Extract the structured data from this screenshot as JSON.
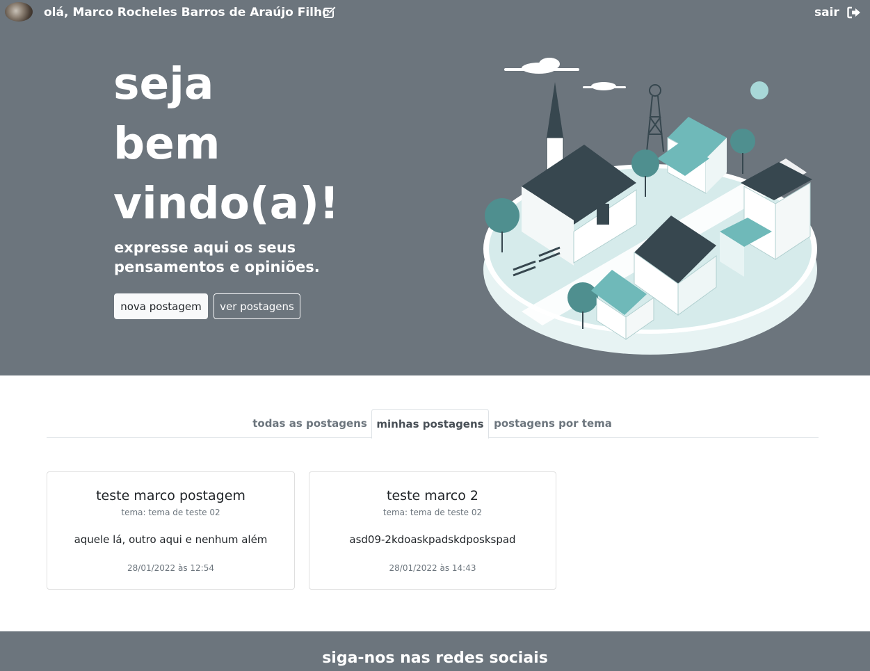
{
  "topbar": {
    "greeting": "olá, Marco Rocheles Barros de Araújo Filho",
    "edit_icon": "edit-icon",
    "logout_label": "sair",
    "logout_icon": "sign-out-icon"
  },
  "hero": {
    "headline": [
      "seja",
      "bem",
      "vindo(a)!"
    ],
    "subline": "expresse aqui os seus pensamentos e opiniões.",
    "new_post_label": "nova postagem",
    "view_posts_label": "ver postagens",
    "illustration": "isometric-town-illustration"
  },
  "tabs": [
    {
      "label": "todas as postagens",
      "active": false
    },
    {
      "label": "minhas postagens",
      "active": true
    },
    {
      "label": "postagens por tema",
      "active": false
    }
  ],
  "posts": [
    {
      "title": "teste marco postagem",
      "theme": "tema: tema de teste 02",
      "text": "aquele lá, outro aqui e nenhum além",
      "date": "28/01/2022 às 12:54"
    },
    {
      "title": "teste marco 2",
      "theme": "tema: tema de teste 02",
      "text": "asd09-2kdoaskpadskdposkspad",
      "date": "28/01/2022 às 14:43"
    }
  ],
  "footer": {
    "title": "siga-nos nas redes sociais"
  },
  "colors": {
    "hero_bg": "#6c757d",
    "accent_teal": "#6fb9b9",
    "dark_slate": "#37474f"
  }
}
